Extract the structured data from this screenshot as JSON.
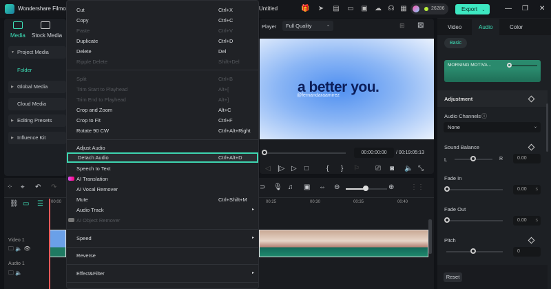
{
  "app": {
    "title": "Wondershare Filmora",
    "document": "Untitled",
    "credits": "26286",
    "export_label": "Export"
  },
  "left_panel": {
    "tabs": [
      {
        "label": "Media"
      },
      {
        "label": "Stock Media"
      }
    ],
    "items": [
      {
        "label": "Project Media"
      },
      {
        "label": "Folder"
      },
      {
        "label": "Global Media"
      },
      {
        "label": "Cloud Media"
      },
      {
        "label": "Editing Presets"
      },
      {
        "label": "Influence Kit"
      }
    ]
  },
  "context_menu": {
    "items": [
      {
        "label": "Cut",
        "shortcut": "Ctrl+X"
      },
      {
        "label": "Copy",
        "shortcut": "Ctrl+C"
      },
      {
        "label": "Paste",
        "shortcut": "Ctrl+V"
      },
      {
        "label": "Duplicate",
        "shortcut": "Ctrl+D"
      },
      {
        "label": "Delete",
        "shortcut": "Del"
      },
      {
        "label": "Ripple Delete",
        "shortcut": "Shift+Del"
      },
      {
        "label": "Split",
        "shortcut": "Ctrl+B"
      },
      {
        "label": "Trim Start to Playhead",
        "shortcut": "Alt+["
      },
      {
        "label": "Trim End to Playhead",
        "shortcut": "Alt+]"
      },
      {
        "label": "Crop and Zoom",
        "shortcut": "Alt+C"
      },
      {
        "label": "Crop to Fit",
        "shortcut": "Ctrl+F"
      },
      {
        "label": "Rotate 90 CW",
        "shortcut": "Ctrl+Alt+Right"
      },
      {
        "label": "Adjust Audio"
      },
      {
        "label": "Detach Audio",
        "shortcut": "Ctrl+Alt+D"
      },
      {
        "label": "Speech to Text"
      },
      {
        "label": "AI Translation"
      },
      {
        "label": "AI Vocal Remover"
      },
      {
        "label": "Mute",
        "shortcut": "Ctrl+Shift+M"
      },
      {
        "label": "Audio Track"
      },
      {
        "label": "AI Object Remover"
      },
      {
        "label": "Speed"
      },
      {
        "label": "Reverse"
      },
      {
        "label": "Effect&Filter"
      }
    ]
  },
  "player": {
    "label": "Player",
    "quality": "Full Quality",
    "headline": "a better you.",
    "handle": "@fernandaraamirez",
    "current_time": "00:00:00:00",
    "total_time": "/ 00:19:05:13"
  },
  "timeline": {
    "ruler": [
      "00:00",
      "00:25",
      "00:30",
      "00:35",
      "00:40"
    ],
    "tracks": [
      {
        "label": "Video 1"
      },
      {
        "label": "Audio 1"
      }
    ]
  },
  "right_panel": {
    "tabs": [
      "Video",
      "Audio",
      "Color"
    ],
    "active_tab": "Audio",
    "basic": "Basic",
    "clip_name": "MORNING MOTIVA...",
    "adjustment": "Adjustment",
    "audio_channels": "Audio Channels",
    "channels_value": "None",
    "sound_balance": "Sound Balance",
    "left": "L",
    "right": "R",
    "balance_value": "0.00",
    "fade_in": "Fade In",
    "fade_in_value": "0.00",
    "fade_out": "Fade Out",
    "fade_out_value": "0.00",
    "unit": "s",
    "pitch": "Pitch",
    "pitch_value": "0",
    "reset": "Reset"
  }
}
